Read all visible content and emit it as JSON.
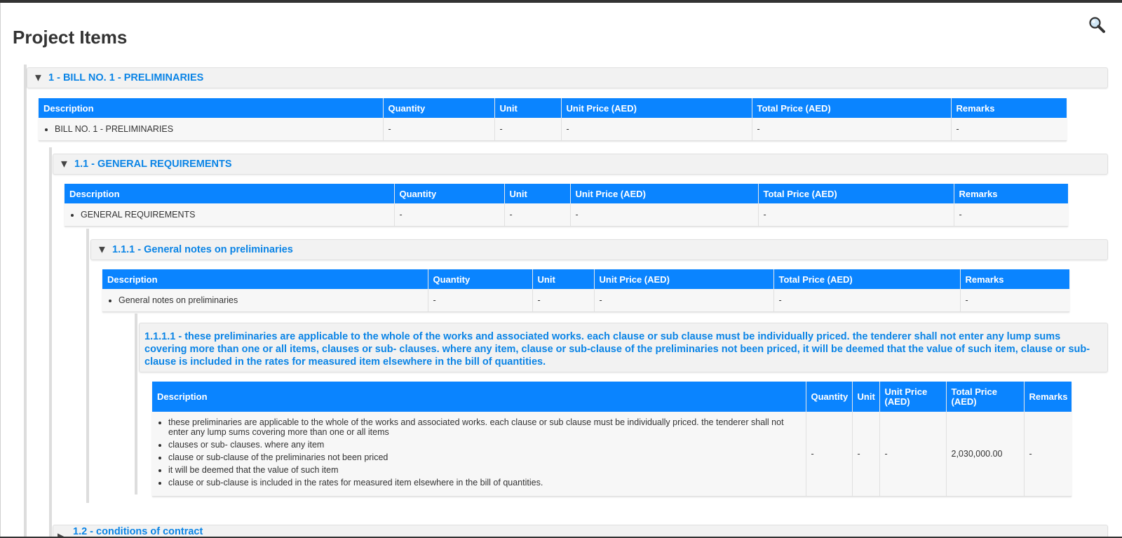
{
  "page": {
    "title": "Project Items",
    "search_icon": "search-icon"
  },
  "columns": [
    "Description",
    "Quantity",
    "Unit",
    "Unit Price (AED)",
    "Total Price (AED)",
    "Remarks"
  ],
  "columns_wrapped": [
    "Description",
    "Quantity",
    "Unit",
    "Unit Price\n(AED)",
    "Total Price\n(AED)",
    "Remarks"
  ],
  "expanded_icon": "▼",
  "collapsed_icon": "▶",
  "sections": {
    "bill1": {
      "title": "1 - BILL NO. 1 - PRELIMINARIES",
      "row": {
        "items": [
          "BILL NO. 1 - PRELIMINARIES"
        ],
        "quantity": "-",
        "unit": "-",
        "unit_price": "-",
        "total_price": "-",
        "remarks": "-"
      }
    },
    "s1_1": {
      "title": "1.1 - GENERAL REQUIREMENTS",
      "row": {
        "items": [
          "GENERAL REQUIREMENTS"
        ],
        "quantity": "-",
        "unit": "-",
        "unit_price": "-",
        "total_price": "-",
        "remarks": "-"
      }
    },
    "s1_1_1": {
      "title": "1.1.1 - General notes on preliminaries",
      "row": {
        "items": [
          "General notes on preliminaries"
        ],
        "quantity": "-",
        "unit": "-",
        "unit_price": "-",
        "total_price": "-",
        "remarks": "-"
      }
    },
    "s1_1_1_1": {
      "title": "1.1.1.1 - these preliminaries are applicable to the whole of the works and associated works. each clause or sub clause must be individually priced. the tenderer shall not enter any lump sums covering more than one or all items, clauses or sub- clauses. where any item, clause or sub-clause of the preliminaries not been priced, it will be deemed that the value of such item, clause or sub-clause is included in the rates for measured item elsewhere in the bill of quantities.",
      "row": {
        "items": [
          "these preliminaries are applicable to the whole of the works and associated works. each clause or sub clause must be individually priced. the tenderer shall not enter any lump sums covering more than one or all items",
          "clauses or sub- clauses. where any item",
          "clause or sub-clause of the preliminaries not been priced",
          "it will be deemed that the value of such item",
          "clause or sub-clause is included in the rates for measured item elsewhere in the bill of quantities."
        ],
        "quantity": "-",
        "unit": "-",
        "unit_price": "-",
        "total_price": "2,030,000.00",
        "remarks": "-"
      }
    },
    "s1_2": {
      "title": "1.2 - conditions of contract"
    }
  }
}
